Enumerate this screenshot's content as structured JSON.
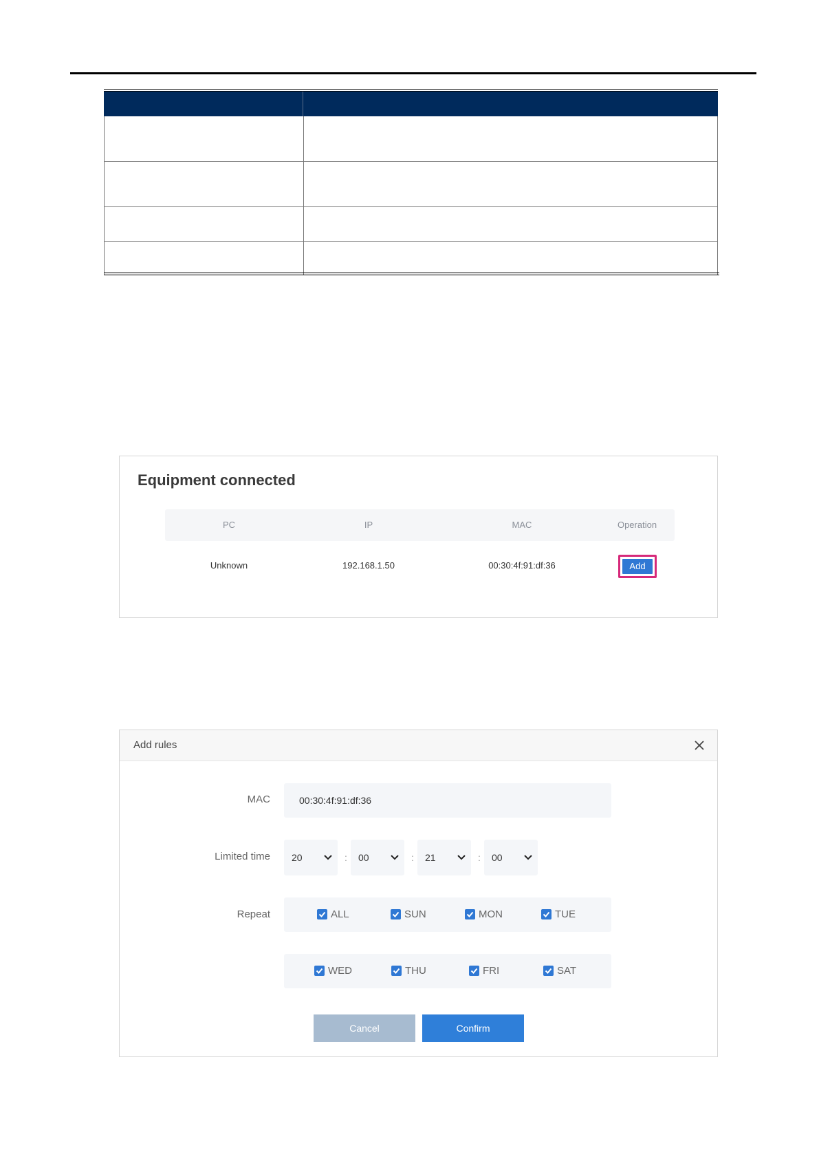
{
  "equipment": {
    "title": "Equipment connected",
    "columns": {
      "pc": "PC",
      "ip": "IP",
      "mac": "MAC",
      "operation": "Operation"
    },
    "rows": [
      {
        "pc": "Unknown",
        "ip": "192.168.1.50",
        "mac": "00:30:4f:91:df:36",
        "operation": "Add"
      }
    ]
  },
  "dialog": {
    "title": "Add rules",
    "mac_label": "MAC",
    "mac_value": "00:30:4f:91:df:36",
    "time_label": "Limited time",
    "start_hour": "20",
    "start_minute": "00",
    "end_hour": "21",
    "end_minute": "00",
    "separator": ":",
    "repeat_label": "Repeat",
    "days_row1": [
      "ALL",
      "SUN",
      "MON",
      "TUE"
    ],
    "days_row2": [
      "WED",
      "THU",
      "FRI",
      "SAT"
    ],
    "cancel_label": "Cancel",
    "confirm_label": "Confirm"
  },
  "colors": {
    "table_header": "#002a5c",
    "accent": "#2f78d4",
    "highlight": "#d6297a",
    "cancel": "#a7bbd0"
  }
}
